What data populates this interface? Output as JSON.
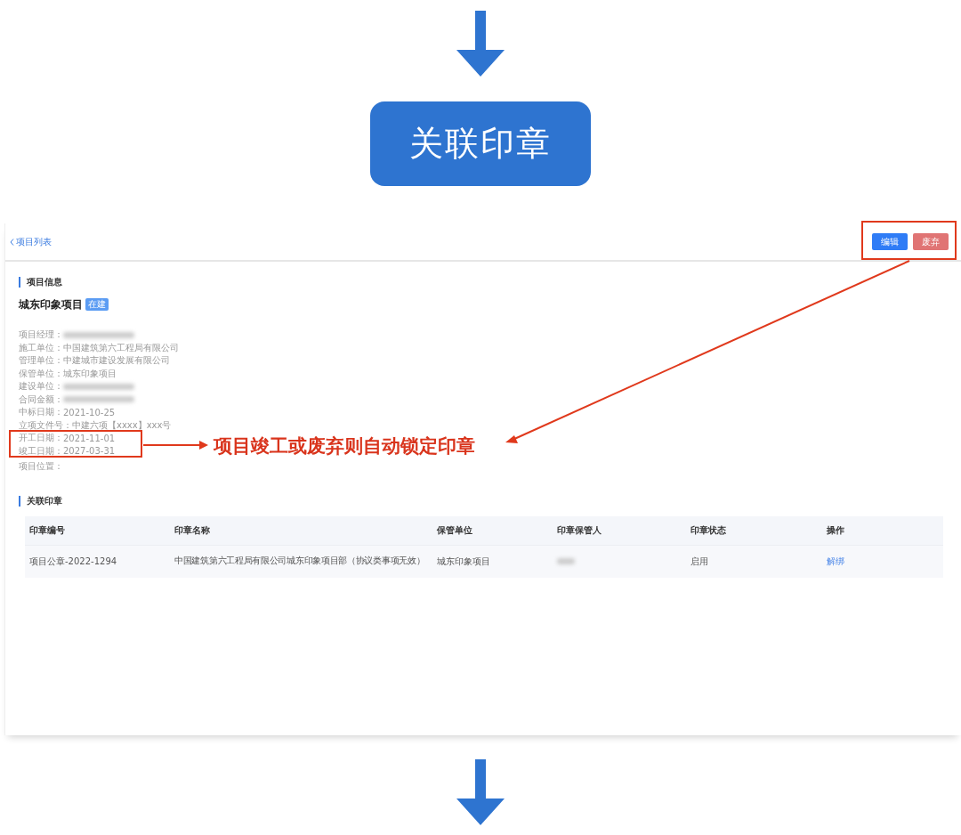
{
  "flow_step": {
    "label": "关联印章"
  },
  "screen": {
    "back_link": "项目列表",
    "buttons": [
      {
        "label": "编辑",
        "kind": "primary"
      },
      {
        "label": "废弃",
        "kind": "danger"
      }
    ],
    "project_info": {
      "title": "项目信息",
      "name": "城东印象项目",
      "badge": "在建",
      "fields": [
        {
          "label": "项目经理：",
          "kind": "blurred"
        },
        {
          "label": "施工单位：",
          "kind": "text",
          "value": "中国建筑第六工程局有限公司"
        },
        {
          "label": "管理单位：",
          "kind": "text",
          "value": "中建城市建设发展有限公司"
        },
        {
          "label": "保管单位：",
          "kind": "text",
          "value": "城东印象项目"
        },
        {
          "label": "建设单位：",
          "kind": "blurred"
        },
        {
          "label": "合同金额：",
          "kind": "blurred"
        },
        {
          "label": "中标日期：",
          "kind": "text",
          "value": "2021-10-25"
        },
        {
          "label": "立项文件号：",
          "kind": "text",
          "value": "中建六项【xxxx】xxx号"
        },
        {
          "label": "开工日期：",
          "kind": "text",
          "value": "2021-11-01"
        },
        {
          "label": "竣工日期：",
          "kind": "text",
          "value": "2027-03-31"
        },
        {
          "label": "项目位置：",
          "kind": "text"
        }
      ]
    },
    "seals": {
      "title": "关联印章",
      "columns": [
        "印章编号",
        "印章名称",
        "保管单位",
        "印章保管人",
        "印章状态",
        "操作"
      ],
      "rows": [
        {
          "cells": [
            {
              "kind": "text",
              "text": "项目公章-2022-1294"
            },
            {
              "kind": "text",
              "text": "中国建筑第六工程局有限公司城东印象项目部（协议类事项无效）"
            },
            {
              "kind": "text",
              "text": "城东印象项目"
            },
            {
              "kind": "blurred"
            },
            {
              "kind": "text",
              "text": "启用"
            },
            {
              "kind": "link",
              "text": "解绑"
            }
          ]
        }
      ]
    }
  },
  "annotation": {
    "text": "项目竣工或废弃则自动锁定印章"
  }
}
